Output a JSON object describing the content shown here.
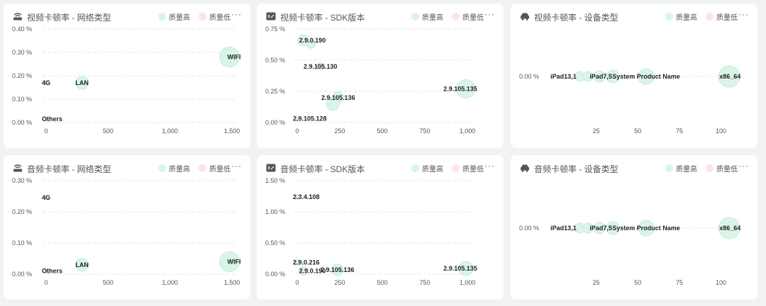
{
  "legend": {
    "high": "质量高",
    "low": "质量低"
  },
  "colors": {
    "high": "#d9f5e8",
    "low": "#fde4e6",
    "highStroke": "#c4ecd8"
  },
  "panels": [
    {
      "id": "video-network",
      "icon": "router-icon",
      "title": "视频卡顿率 - 网络类型"
    },
    {
      "id": "video-sdk",
      "icon": "code-icon",
      "title": "视频卡顿率 - SDK版本"
    },
    {
      "id": "video-device",
      "icon": "car-icon",
      "title": "视频卡顿率 - 设备类型"
    },
    {
      "id": "audio-network",
      "icon": "router-icon",
      "title": "音频卡顿率 - 网络类型"
    },
    {
      "id": "audio-sdk",
      "icon": "code-icon",
      "title": "音频卡顿率 - SDK版本"
    },
    {
      "id": "audio-device",
      "icon": "car-icon",
      "title": "音频卡顿率 - 设备类型"
    }
  ],
  "chart_data": [
    {
      "type": "scatter",
      "title": "视频卡顿率 - 网络类型",
      "xlim": [
        0,
        1500
      ],
      "ylim": [
        0,
        0.4
      ],
      "xticks": [
        "0",
        "500",
        "1,000",
        "1,500"
      ],
      "yticks": [
        "0.00 %",
        "0.10 %",
        "0.20 %",
        "0.30 %",
        "0.40 %"
      ],
      "points": [
        {
          "label": "WIFI",
          "x": 1480,
          "y": 0.28,
          "size": 14
        },
        {
          "label": "LAN",
          "x": 290,
          "y": 0.17,
          "size": 9
        },
        {
          "label": "4G",
          "x": 0,
          "y": 0.17,
          "size": 3
        },
        {
          "label": "Others",
          "x": 0,
          "y": 0.015,
          "size": 3
        }
      ]
    },
    {
      "type": "scatter",
      "title": "视频卡顿率 - SDK版本",
      "xlim": [
        0,
        1100
      ],
      "ylim": [
        0,
        0.75
      ],
      "xticks": [
        "0",
        "250",
        "500",
        "750",
        "1,000"
      ],
      "yticks": [
        "0.00 %",
        "0.25 %",
        "0.50 %",
        "0.75 %"
      ],
      "points": [
        {
          "label": "2.9.0.190",
          "x": 40,
          "y": 0.66,
          "size": 8
        },
        {
          "label": "",
          "x": 90,
          "y": 0.63,
          "size": 6
        },
        {
          "label": "2.9.105.130",
          "x": 150,
          "y": 0.45,
          "size": 5
        },
        {
          "label": "2.9.105.136",
          "x": 265,
          "y": 0.2,
          "size": 8
        },
        {
          "label": "",
          "x": 230,
          "y": 0.15,
          "size": 9
        },
        {
          "label": "2.9.105.128",
          "x": 0,
          "y": 0.03,
          "size": 3
        },
        {
          "label": "2.9.105.135",
          "x": 1090,
          "y": 0.27,
          "size": 13
        }
      ]
    },
    {
      "type": "scatter",
      "title": "视频卡顿率 - 设备类型",
      "xlim": [
        0,
        110
      ],
      "ylim": [
        0,
        0
      ],
      "xticks": [
        "25",
        "50",
        "75",
        "100"
      ],
      "yticks": [
        "0.00 %"
      ],
      "points": [
        {
          "label": "iPad13,1",
          "x": 15,
          "y": 0,
          "size": 7
        },
        {
          "label": "",
          "x": 20,
          "y": 0,
          "size": 7
        },
        {
          "label": "iPad7,5",
          "x": 27,
          "y": 0,
          "size": 8
        },
        {
          "label": "",
          "x": 35,
          "y": 0,
          "size": 9
        },
        {
          "label": "System Product Name",
          "x": 55,
          "y": 0,
          "size": 11
        },
        {
          "label": "x86_64",
          "x": 105,
          "y": 0,
          "size": 15
        }
      ]
    },
    {
      "type": "scatter",
      "title": "音频卡顿率 - 网络类型",
      "xlim": [
        0,
        1500
      ],
      "ylim": [
        0,
        0.3
      ],
      "xticks": [
        "0",
        "500",
        "1,000",
        "1,500"
      ],
      "yticks": [
        "0.00 %",
        "0.10 %",
        "0.20 %",
        "0.30 %"
      ],
      "points": [
        {
          "label": "WIFI",
          "x": 1480,
          "y": 0.04,
          "size": 14
        },
        {
          "label": "LAN",
          "x": 290,
          "y": 0.03,
          "size": 9
        },
        {
          "label": "4G",
          "x": 0,
          "y": 0.245,
          "size": 3
        },
        {
          "label": "Others",
          "x": 0,
          "y": 0.01,
          "size": 3
        }
      ]
    },
    {
      "type": "scatter",
      "title": "音频卡顿率 - SDK版本",
      "xlim": [
        0,
        1100
      ],
      "ylim": [
        0,
        1.5
      ],
      "xticks": [
        "0",
        "250",
        "500",
        "750",
        "1,000"
      ],
      "yticks": [
        "0.00 %",
        "0.50 %",
        "1.00 %",
        "1.50 %"
      ],
      "points": [
        {
          "label": "2.3.4.108",
          "x": 0,
          "y": 1.24,
          "size": 3
        },
        {
          "label": "2.9.0.216",
          "x": 0,
          "y": 0.19,
          "size": 4
        },
        {
          "label": "2.9.0.190",
          "x": 40,
          "y": 0.05,
          "size": 6
        },
        {
          "label": "2.9.105.136",
          "x": 260,
          "y": 0.07,
          "size": 8
        },
        {
          "label": "2.9.105.135",
          "x": 1090,
          "y": 0.09,
          "size": 10
        }
      ]
    },
    {
      "type": "scatter",
      "title": "音频卡顿率 - 设备类型",
      "xlim": [
        0,
        110
      ],
      "ylim": [
        0,
        0
      ],
      "xticks": [
        "25",
        "50",
        "75",
        "100"
      ],
      "yticks": [
        "0.00 %"
      ],
      "points": [
        {
          "label": "iPad13,1",
          "x": 15,
          "y": 0,
          "size": 7
        },
        {
          "label": "",
          "x": 20,
          "y": 0,
          "size": 7
        },
        {
          "label": "iPad7,5",
          "x": 27,
          "y": 0,
          "size": 8
        },
        {
          "label": "",
          "x": 35,
          "y": 0,
          "size": 9
        },
        {
          "label": "System Product Name",
          "x": 55,
          "y": 0,
          "size": 11
        },
        {
          "label": "x86_64",
          "x": 105,
          "y": 0,
          "size": 15
        }
      ]
    }
  ]
}
